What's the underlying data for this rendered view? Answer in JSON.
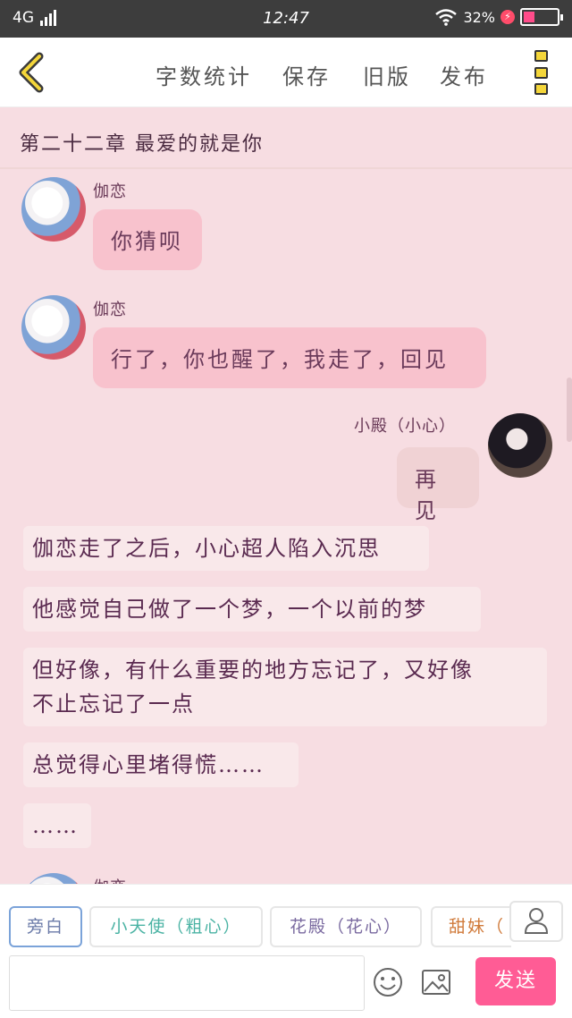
{
  "status_bar": {
    "network": "4G",
    "time": "12:47",
    "battery": "32%"
  },
  "toolbar": {
    "items": [
      "字数统计",
      "保存",
      "旧版",
      "发布"
    ]
  },
  "chapter": {
    "title": "第二十二章 最爱的就是你"
  },
  "chat": {
    "messages": [
      {
        "speaker": "伽恋",
        "text": "你猜呗"
      },
      {
        "speaker": "伽恋",
        "text": "行了，你也醒了，我走了，回见"
      },
      {
        "speaker": "小殿（小心）",
        "text": "再见"
      }
    ],
    "narration": [
      "伽恋走了之后，小心超人陷入沉思",
      "他感觉自己做了一个梦，一个以前的梦",
      "但好像，有什么重要的地方忘记了，又好像",
      "不止忘记了一点",
      "总觉得心里堵得慌……",
      "……"
    ],
    "partial_speaker": "伽恋"
  },
  "role_bar": {
    "roles": [
      "旁白",
      "小天使（粗心）",
      "花殿（花心）",
      "甜妹（"
    ]
  },
  "input_bar": {
    "input_value": "",
    "send_label": "发送"
  },
  "colors": {
    "background": "#f7dde2",
    "bubble_left": "#f8c2cd",
    "bubble_right": "#f0d2d4",
    "narration_bg": "#f9e8ea",
    "send_button": "#ff5c95",
    "menu_icon": "#f4d63a",
    "role_teal": "#4bb3a4",
    "role_purple": "#7a6aa0",
    "role_orange": "#d07a3a"
  },
  "icons": [
    "back-chevron-icon",
    "menu-dots-icon",
    "profile-icon",
    "emoji-icon",
    "image-icon",
    "wifi-icon",
    "signal-icon",
    "battery-icon"
  ]
}
